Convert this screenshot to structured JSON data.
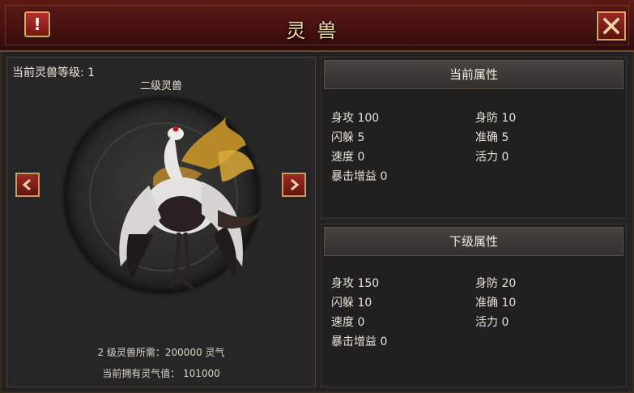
{
  "title": "灵兽",
  "info_button_label": "!",
  "close_icon": "close-x-icon",
  "left": {
    "level_label": "当前灵兽等级: 1",
    "pet_name": "二级灵兽",
    "cost_text": "2 级灵兽所需：200000 灵气",
    "owned_text": "当前拥有灵气值： 101000",
    "prev_icon": "chevron-left-icon",
    "next_icon": "chevron-right-icon"
  },
  "current": {
    "header": "当前属性",
    "stats": [
      {
        "label": "身攻 100"
      },
      {
        "label": "身防 10"
      },
      {
        "label": "闪躲 5"
      },
      {
        "label": "准确 5"
      },
      {
        "label": "速度 0"
      },
      {
        "label": "活力 0"
      },
      {
        "label": "暴击增益 0"
      }
    ]
  },
  "next": {
    "header": "下级属性",
    "stats": [
      {
        "label": "身攻 150"
      },
      {
        "label": "身防 20"
      },
      {
        "label": "闪躲 10"
      },
      {
        "label": "准确 10"
      },
      {
        "label": "速度 0"
      },
      {
        "label": "活力 0"
      },
      {
        "label": "暴击增益 0"
      }
    ]
  },
  "colors": {
    "title_gold": "#f3d89a",
    "titlebar_red": "#481210",
    "button_red": "#9a2a22"
  }
}
